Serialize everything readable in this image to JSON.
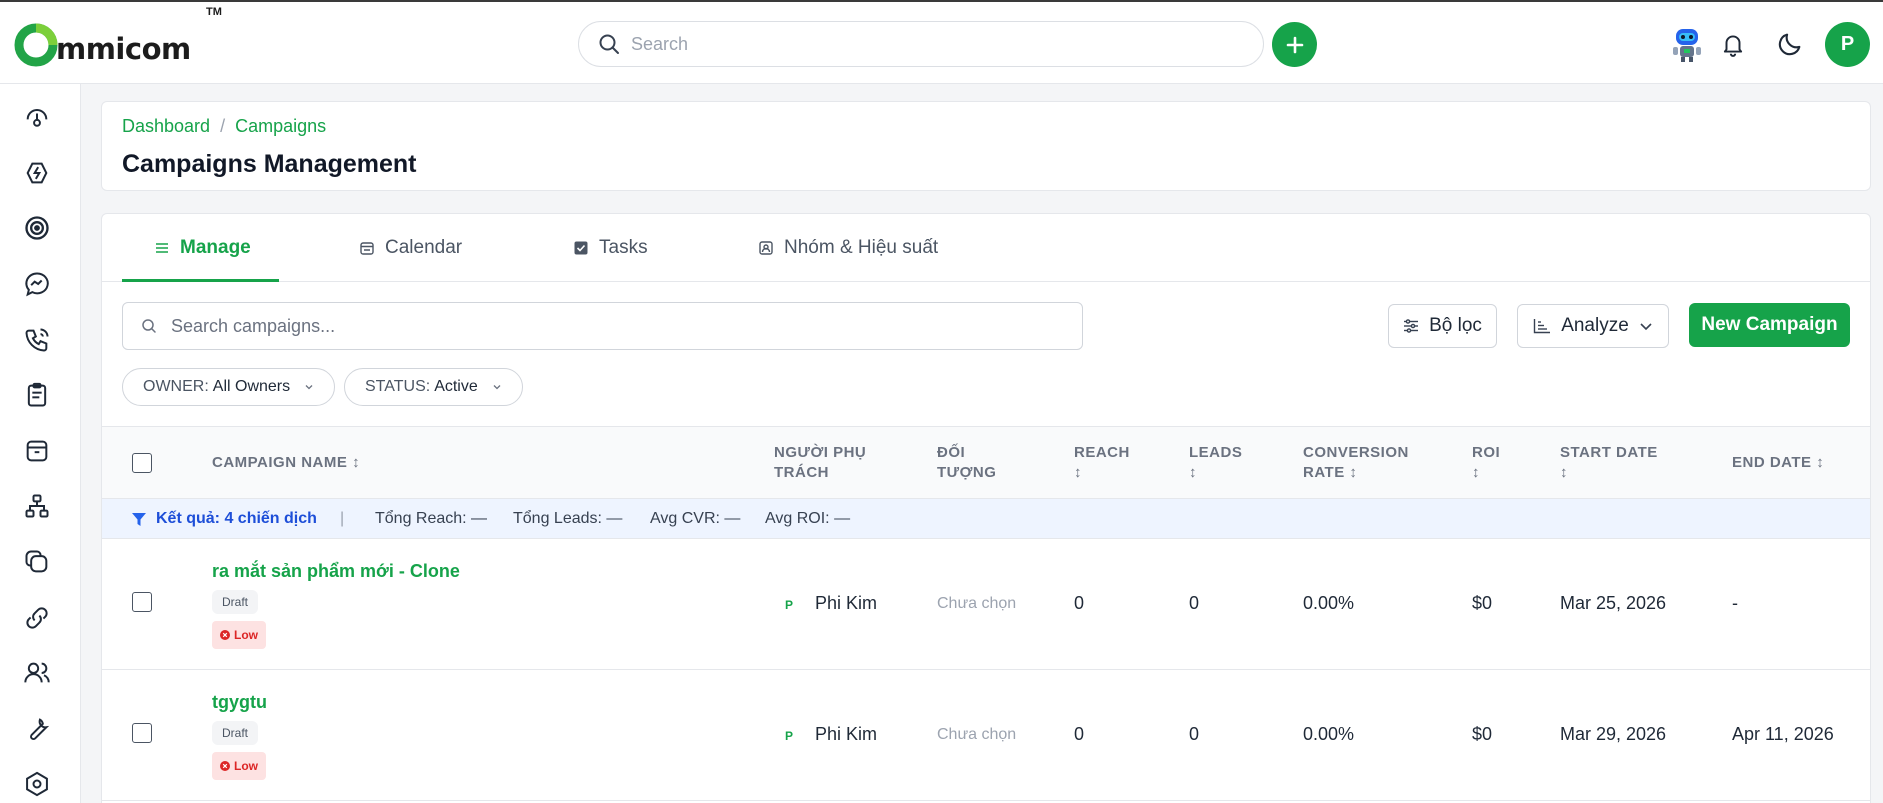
{
  "brand": {
    "logo_text": "mmicom",
    "logo_tm": "TM"
  },
  "header": {
    "search_placeholder": "Search",
    "avatar_initial": "P"
  },
  "sidebar": {
    "items": [
      {
        "name": "dashboard-gauge-icon"
      },
      {
        "name": "integrations-icon"
      },
      {
        "name": "target-icon"
      },
      {
        "name": "messenger-icon"
      },
      {
        "name": "phone-icon"
      },
      {
        "name": "clipboard-icon"
      },
      {
        "name": "archive-icon"
      },
      {
        "name": "hierarchy-icon"
      },
      {
        "name": "stacked-shapes-icon"
      },
      {
        "name": "link-icon"
      },
      {
        "name": "users-icon"
      },
      {
        "name": "wrench-icon"
      },
      {
        "name": "settings-hex-icon"
      }
    ]
  },
  "breadcrumb": {
    "home": "Dashboard",
    "sep": "/",
    "current": "Campaigns"
  },
  "page": {
    "title": "Campaigns Management"
  },
  "tabs": [
    {
      "label": "Manage",
      "icon": "list-icon",
      "active": true
    },
    {
      "label": "Calendar",
      "icon": "calendar-icon",
      "active": false
    },
    {
      "label": "Tasks",
      "icon": "checkbox-icon",
      "active": false
    },
    {
      "label": "Nhóm & Hiệu suất",
      "icon": "person-card-icon",
      "active": false
    }
  ],
  "toolbar": {
    "search_placeholder": "Search campaigns...",
    "filter_label": "Bộ lọc",
    "analyze_label": "Analyze",
    "new_campaign_label": "New Campaign"
  },
  "filters": {
    "owner": {
      "key": "OWNER:",
      "value": "All Owners"
    },
    "status": {
      "key": "STATUS:",
      "value": "Active"
    }
  },
  "table": {
    "columns": {
      "name": "CAMPAIGN NAME",
      "owner_l1": "NGƯỜI PHỤ",
      "owner_l2": "TRÁCH",
      "target_l1": "ĐỐI",
      "target_l2": "TƯỢNG",
      "reach": "REACH",
      "leads": "LEADS",
      "cvr_l1": "CONVERSION",
      "cvr_l2": "RATE",
      "roi": "ROI",
      "start": "START DATE",
      "end": "END DATE",
      "sort_glyph": "↕"
    },
    "summary": {
      "results": "Kết quả: 4 chiến dịch",
      "divider": "|",
      "reach": "Tổng Reach: —",
      "leads": "Tổng Leads: —",
      "cvr": "Avg CVR: —",
      "roi": "Avg ROI: —"
    },
    "rows": [
      {
        "name": "ra mắt sản phẩm mới - Clone",
        "status": "Draft",
        "priority": "Low",
        "owner_initial": "P",
        "owner": "Phi Kim",
        "target": "Chưa chọn",
        "reach": "0",
        "leads": "0",
        "cvr": "0.00%",
        "roi": "$0",
        "start": "Mar 25, 2026",
        "end": "-"
      },
      {
        "name": "tgygtu",
        "status": "Draft",
        "priority": "Low",
        "owner_initial": "P",
        "owner": "Phi Kim",
        "target": "Chưa chọn",
        "reach": "0",
        "leads": "0",
        "cvr": "0.00%",
        "roi": "$0",
        "start": "Mar 29, 2026",
        "end": "Apr 11, 2026"
      }
    ]
  },
  "colors": {
    "brand_green": "#16a34a",
    "summary_bg": "#eef4ff",
    "low_red": "#dc2626"
  }
}
